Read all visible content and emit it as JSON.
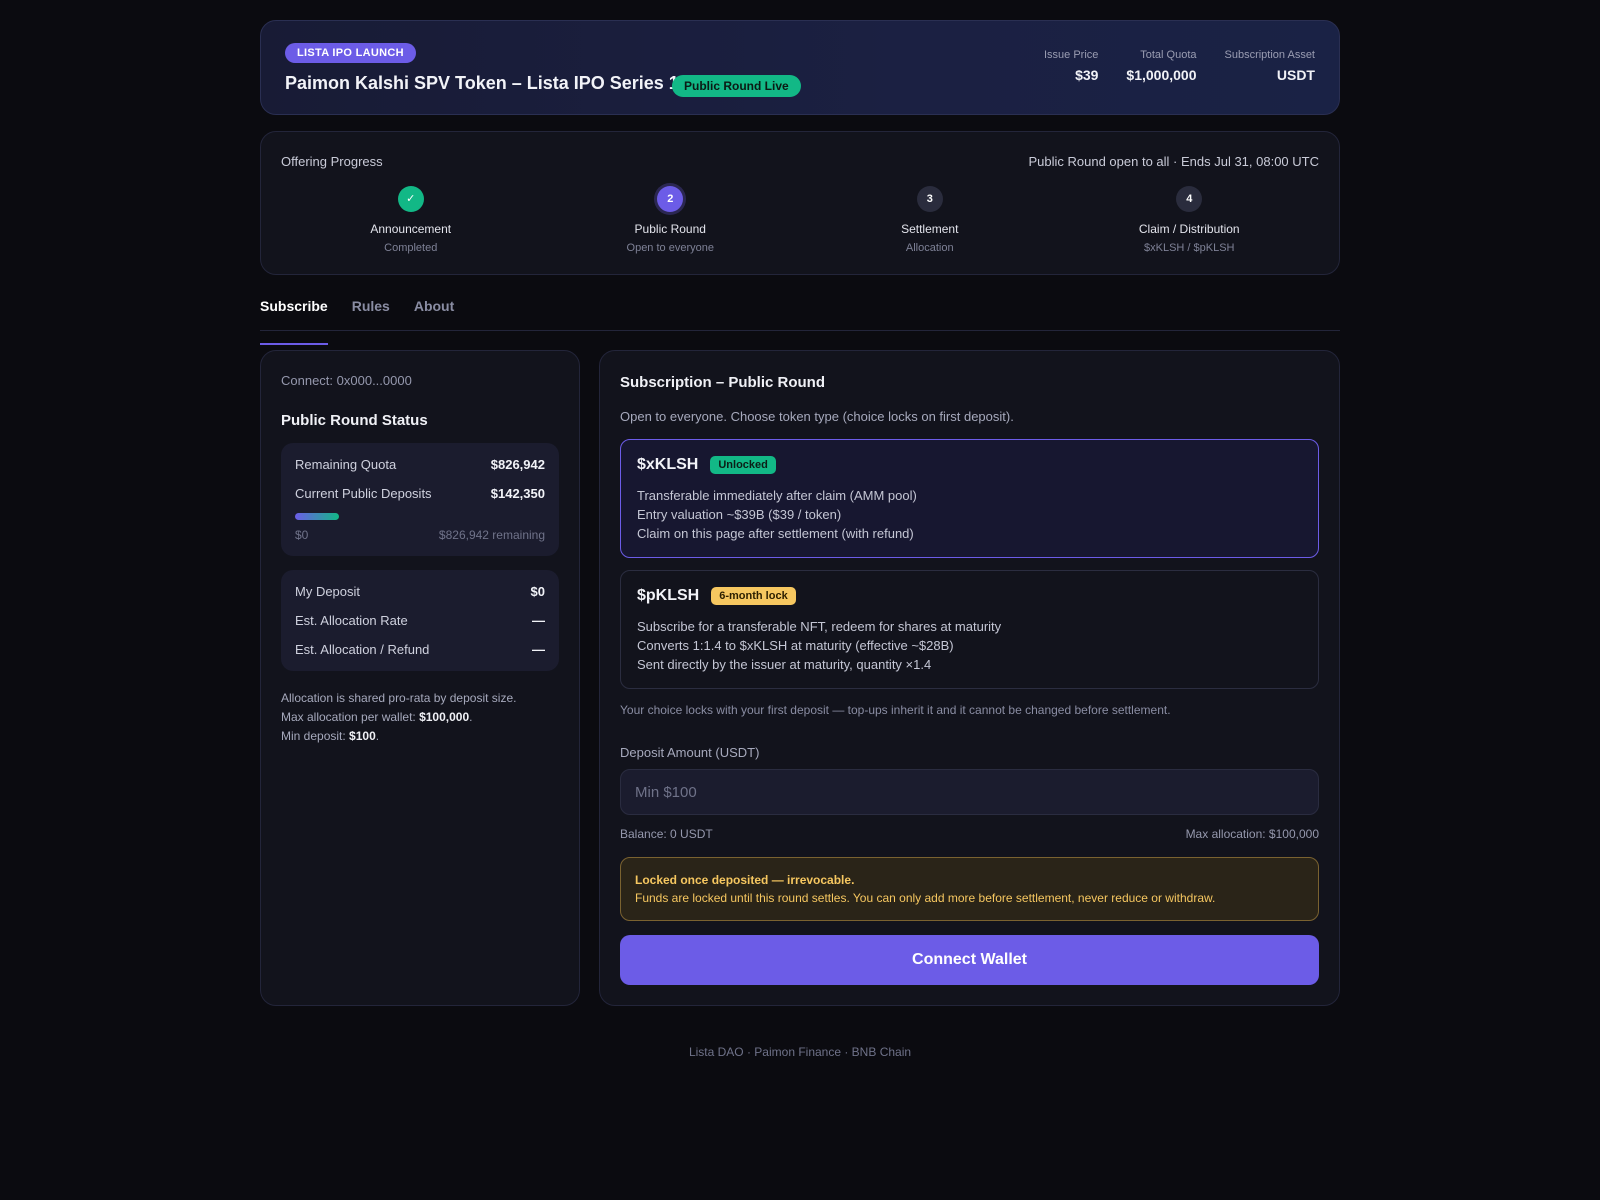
{
  "header": {
    "launch_badge": "LISTA IPO LAUNCH",
    "title": "Paimon Kalshi SPV Token – Lista IPO Series 1",
    "status_badge": "Public Round Live",
    "stats": [
      {
        "label": "Issue Price",
        "value": "$39"
      },
      {
        "label": "Total Quota",
        "value": "$1,000,000"
      },
      {
        "label": "Subscription Asset",
        "value": "USDT"
      }
    ]
  },
  "progress": {
    "title": "Offering Progress",
    "note": "Public Round open to all · Ends Jul 31, 08:00 UTC",
    "steps": [
      {
        "marker": "✓",
        "name": "Announcement",
        "sub": "Completed",
        "state": "done"
      },
      {
        "marker": "2",
        "name": "Public Round",
        "sub": "Open to everyone",
        "state": "active"
      },
      {
        "marker": "3",
        "name": "Settlement",
        "sub": "Allocation",
        "state": "pending"
      },
      {
        "marker": "4",
        "name": "Claim / Distribution",
        "sub": "$xKLSH / $pKLSH",
        "state": "pending"
      }
    ]
  },
  "tabs": [
    {
      "label": "Subscribe",
      "active": true
    },
    {
      "label": "Rules",
      "active": false
    },
    {
      "label": "About",
      "active": false
    }
  ],
  "status_panel": {
    "connect": "Connect: 0x000...0000",
    "title": "Public Round Status",
    "remaining_label": "Remaining Quota",
    "remaining_value": "$826,942",
    "deposits_label": "Current Public Deposits",
    "deposits_value": "$142,350",
    "bar_min": "$0",
    "bar_remaining": "$826,942 remaining",
    "my_deposit_label": "My Deposit",
    "my_deposit_value": "$0",
    "alloc_rate_label": "Est. Allocation Rate",
    "alloc_rate_value": "—",
    "alloc_refund_label": "Est. Allocation / Refund",
    "alloc_refund_value": "—",
    "note_line1": "Allocation is shared pro-rata by deposit size.",
    "note_line2_prefix": "Max allocation per wallet: ",
    "note_line2_value": "$100,000",
    "note_line3_prefix": "Min deposit: ",
    "note_line3_value": "$100"
  },
  "subscription": {
    "title": "Subscription – Public Round",
    "desc": "Open to everyone. Choose token type (choice locks on first deposit).",
    "options": [
      {
        "name": "$xKLSH",
        "tag": "Unlocked",
        "lines": [
          "Transferable immediately after claim (AMM pool)",
          "Entry valuation ~$39B ($39 / token)",
          "Claim on this page after settlement (with refund)"
        ]
      },
      {
        "name": "$pKLSH",
        "tag": "6-month lock",
        "lines": [
          "Subscribe for a transferable NFT, redeem for shares at maturity",
          "Converts 1:1.4 to $xKLSH at maturity (effective ~$28B)",
          "Sent directly by the issuer at maturity, quantity ×1.4"
        ]
      }
    ],
    "lock_note": "Your choice locks with your first deposit — top-ups inherit it and it cannot be changed before settlement.",
    "deposit_label": "Deposit Amount (USDT)",
    "deposit_placeholder": "Min $100",
    "balance": "Balance: 0 USDT",
    "max_allocation": "Max allocation: $100,000",
    "warning_title": "Locked once deposited — irrevocable.",
    "warning_body": "Funds are locked until this round settles. You can only add more before settlement, never reduce or withdraw.",
    "cta": "Connect Wallet"
  },
  "footer": "Lista DAO · Paimon Finance · BNB Chain",
  "colors": {
    "accent": "#6c5ce7",
    "success": "#12b886",
    "warning": "#f6c760",
    "background": "#0b0b10"
  }
}
